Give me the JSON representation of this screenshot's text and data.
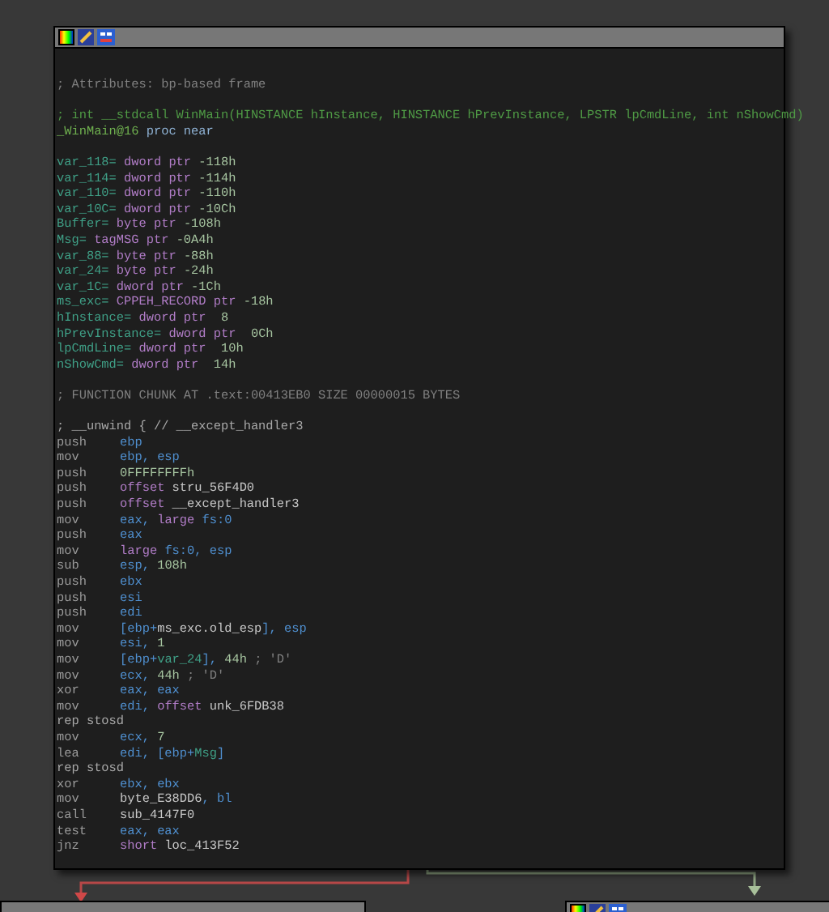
{
  "node": {
    "blocks": [
      {
        "lines": [
          {
            "segs": [
              {
                "kind": "c",
                "text": "; Attributes: bp-based frame"
              }
            ]
          }
        ]
      },
      {
        "lines": [
          {
            "segs": [
              {
                "kind": "gc",
                "text": "; int __stdcall WinMain(HINSTANCE hInstance, HINSTANCE hPrevInstance, LPSTR lpCmdLine, int nShowCmd)"
              }
            ]
          },
          {
            "segs": [
              {
                "kind": "fn",
                "text": "_WinMain@16"
              },
              {
                "kind": "kw",
                "text": " proc near"
              }
            ]
          }
        ]
      },
      {
        "lines": [
          {
            "segs": [
              {
                "kind": "var",
                "text": "var_118="
              },
              {
                "kind": "ty",
                "text": " dword ptr "
              },
              {
                "kind": "num",
                "text": "-118h"
              }
            ]
          },
          {
            "segs": [
              {
                "kind": "var",
                "text": "var_114="
              },
              {
                "kind": "ty",
                "text": " dword ptr "
              },
              {
                "kind": "num",
                "text": "-114h"
              }
            ]
          },
          {
            "segs": [
              {
                "kind": "var",
                "text": "var_110="
              },
              {
                "kind": "ty",
                "text": " dword ptr "
              },
              {
                "kind": "num",
                "text": "-110h"
              }
            ]
          },
          {
            "segs": [
              {
                "kind": "var",
                "text": "var_10C="
              },
              {
                "kind": "ty",
                "text": " dword ptr "
              },
              {
                "kind": "num",
                "text": "-10Ch"
              }
            ]
          },
          {
            "segs": [
              {
                "kind": "var",
                "text": "Buffer="
              },
              {
                "kind": "ty",
                "text": " byte ptr "
              },
              {
                "kind": "num",
                "text": "-108h"
              }
            ]
          },
          {
            "segs": [
              {
                "kind": "var",
                "text": "Msg="
              },
              {
                "kind": "ty",
                "text": " tagMSG ptr "
              },
              {
                "kind": "num",
                "text": "-0A4h"
              }
            ]
          },
          {
            "segs": [
              {
                "kind": "var",
                "text": "var_88="
              },
              {
                "kind": "ty",
                "text": " byte ptr "
              },
              {
                "kind": "num",
                "text": "-88h"
              }
            ]
          },
          {
            "segs": [
              {
                "kind": "var",
                "text": "var_24="
              },
              {
                "kind": "ty",
                "text": " byte ptr "
              },
              {
                "kind": "num",
                "text": "-24h"
              }
            ]
          },
          {
            "segs": [
              {
                "kind": "var",
                "text": "var_1C="
              },
              {
                "kind": "ty",
                "text": " dword ptr "
              },
              {
                "kind": "num",
                "text": "-1Ch"
              }
            ]
          },
          {
            "segs": [
              {
                "kind": "var",
                "text": "ms_exc="
              },
              {
                "kind": "ty",
                "text": " CPPEH_RECORD ptr "
              },
              {
                "kind": "num",
                "text": "-18h"
              }
            ]
          },
          {
            "segs": [
              {
                "kind": "var",
                "text": "hInstance="
              },
              {
                "kind": "ty",
                "text": " dword ptr "
              },
              {
                "kind": "num",
                "text": " 8"
              }
            ]
          },
          {
            "segs": [
              {
                "kind": "var",
                "text": "hPrevInstance="
              },
              {
                "kind": "ty",
                "text": " dword ptr "
              },
              {
                "kind": "num",
                "text": " 0Ch"
              }
            ]
          },
          {
            "segs": [
              {
                "kind": "var",
                "text": "lpCmdLine="
              },
              {
                "kind": "ty",
                "text": " dword ptr "
              },
              {
                "kind": "num",
                "text": " 10h"
              }
            ]
          },
          {
            "segs": [
              {
                "kind": "var",
                "text": "nShowCmd="
              },
              {
                "kind": "ty",
                "text": " dword ptr "
              },
              {
                "kind": "num",
                "text": " 14h"
              }
            ]
          }
        ]
      },
      {
        "lines": [
          {
            "segs": [
              {
                "kind": "c",
                "text": "; FUNCTION CHUNK AT .text:00413EB0 SIZE 00000015 BYTES"
              }
            ]
          }
        ]
      },
      {
        "lines": [
          {
            "segs": [
              {
                "kind": "lc",
                "text": "; __unwind { // __except_handler3"
              }
            ]
          },
          {
            "segs": [
              {
                "kind": "mn",
                "text": "push"
              },
              {
                "kind": "reg",
                "text": "ebp"
              }
            ]
          },
          {
            "segs": [
              {
                "kind": "mn",
                "text": "mov"
              },
              {
                "kind": "reg",
                "text": "ebp, esp"
              }
            ]
          },
          {
            "segs": [
              {
                "kind": "mn",
                "text": "push"
              },
              {
                "kind": "num",
                "text": "0FFFFFFFFh"
              }
            ]
          },
          {
            "segs": [
              {
                "kind": "mn",
                "text": "push"
              },
              {
                "kind": "ty",
                "text": "offset "
              },
              {
                "kind": "sym",
                "text": "stru_56F4D0"
              }
            ]
          },
          {
            "segs": [
              {
                "kind": "mn",
                "text": "push"
              },
              {
                "kind": "ty",
                "text": "offset "
              },
              {
                "kind": "sym",
                "text": "__except_handler3"
              }
            ]
          },
          {
            "segs": [
              {
                "kind": "mn",
                "text": "mov"
              },
              {
                "kind": "reg",
                "text": "eax, "
              },
              {
                "kind": "ty",
                "text": "large "
              },
              {
                "kind": "reg",
                "text": "fs:0"
              }
            ]
          },
          {
            "segs": [
              {
                "kind": "mn",
                "text": "push"
              },
              {
                "kind": "reg",
                "text": "eax"
              }
            ]
          },
          {
            "segs": [
              {
                "kind": "mn",
                "text": "mov"
              },
              {
                "kind": "ty",
                "text": "large "
              },
              {
                "kind": "reg",
                "text": "fs:0, esp"
              }
            ]
          },
          {
            "segs": [
              {
                "kind": "mn",
                "text": "sub"
              },
              {
                "kind": "reg",
                "text": "esp, "
              },
              {
                "kind": "num",
                "text": "108h"
              }
            ]
          },
          {
            "segs": [
              {
                "kind": "mn",
                "text": "push"
              },
              {
                "kind": "reg",
                "text": "ebx"
              }
            ]
          },
          {
            "segs": [
              {
                "kind": "mn",
                "text": "push"
              },
              {
                "kind": "reg",
                "text": "esi"
              }
            ]
          },
          {
            "segs": [
              {
                "kind": "mn",
                "text": "push"
              },
              {
                "kind": "reg",
                "text": "edi"
              }
            ]
          },
          {
            "segs": [
              {
                "kind": "mn",
                "text": "mov"
              },
              {
                "kind": "reg",
                "text": "[ebp+"
              },
              {
                "kind": "sym",
                "text": "ms_exc.old_esp"
              },
              {
                "kind": "reg",
                "text": "], esp"
              }
            ]
          },
          {
            "segs": [
              {
                "kind": "mn",
                "text": "mov"
              },
              {
                "kind": "reg",
                "text": "esi, "
              },
              {
                "kind": "num",
                "text": "1"
              }
            ]
          },
          {
            "segs": [
              {
                "kind": "mn",
                "text": "mov"
              },
              {
                "kind": "reg",
                "text": "[ebp+"
              },
              {
                "kind": "var",
                "text": "var_24"
              },
              {
                "kind": "reg",
                "text": "], "
              },
              {
                "kind": "num",
                "text": "44h"
              },
              {
                "kind": "c",
                "text": " ; 'D'"
              }
            ]
          },
          {
            "segs": [
              {
                "kind": "mn",
                "text": "mov"
              },
              {
                "kind": "reg",
                "text": "ecx, "
              },
              {
                "kind": "num",
                "text": "44h"
              },
              {
                "kind": "c",
                "text": " ; 'D'"
              }
            ]
          },
          {
            "segs": [
              {
                "kind": "mn",
                "text": "xor"
              },
              {
                "kind": "reg",
                "text": "eax, eax"
              }
            ]
          },
          {
            "segs": [
              {
                "kind": "mn",
                "text": "mov"
              },
              {
                "kind": "reg",
                "text": "edi, "
              },
              {
                "kind": "ty",
                "text": "offset "
              },
              {
                "kind": "sym",
                "text": "unk_6FDB38"
              }
            ]
          },
          {
            "segs": [
              {
                "kind": "mn2",
                "text": "rep stosd"
              }
            ]
          },
          {
            "segs": [
              {
                "kind": "mn",
                "text": "mov"
              },
              {
                "kind": "reg",
                "text": "ecx, "
              },
              {
                "kind": "num",
                "text": "7"
              }
            ]
          },
          {
            "segs": [
              {
                "kind": "mn",
                "text": "lea"
              },
              {
                "kind": "reg",
                "text": "edi, [ebp+"
              },
              {
                "kind": "var",
                "text": "Msg"
              },
              {
                "kind": "reg",
                "text": "]"
              }
            ]
          },
          {
            "segs": [
              {
                "kind": "mn2",
                "text": "rep stosd"
              }
            ]
          },
          {
            "segs": [
              {
                "kind": "mn",
                "text": "xor"
              },
              {
                "kind": "reg",
                "text": "ebx, ebx"
              }
            ]
          },
          {
            "segs": [
              {
                "kind": "mn",
                "text": "mov"
              },
              {
                "kind": "sym",
                "text": "byte_E38DD6"
              },
              {
                "kind": "reg",
                "text": ", bl"
              }
            ]
          },
          {
            "segs": [
              {
                "kind": "mn",
                "text": "call"
              },
              {
                "kind": "sym",
                "text": "sub_4147F0"
              }
            ]
          },
          {
            "segs": [
              {
                "kind": "mn",
                "text": "test"
              },
              {
                "kind": "reg",
                "text": "eax, eax"
              }
            ]
          },
          {
            "segs": [
              {
                "kind": "mn",
                "text": "jnz"
              },
              {
                "kind": "ty",
                "text": "short "
              },
              {
                "kind": "sym",
                "text": "loc_413F52"
              }
            ]
          }
        ]
      }
    ]
  }
}
